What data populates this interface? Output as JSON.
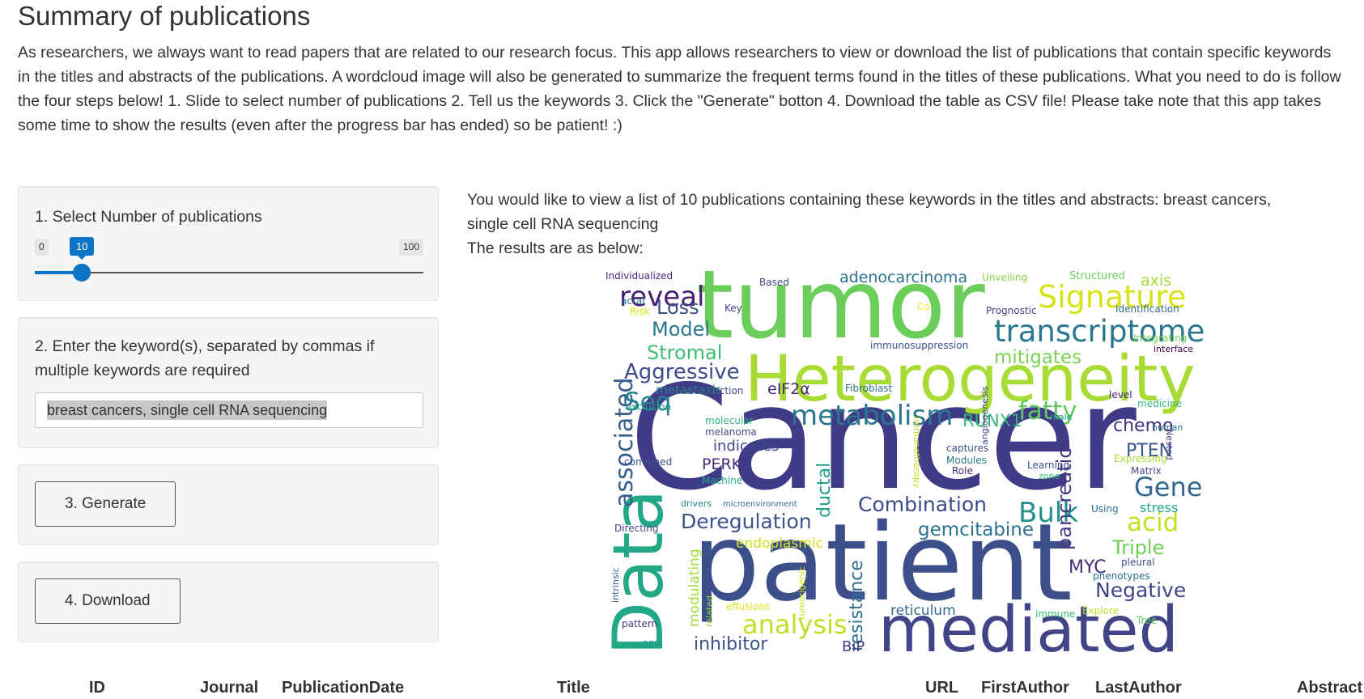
{
  "page": {
    "title": "Summary of publications",
    "intro": "As researchers, we always want to read papers that are related to our research focus. This app allows researchers to view or download the list of publications that contain specific keywords in the titles and abstracts of the publications. A wordcloud image will also be generated to summarize the frequent terms found in the titles of these publications. What you need to do is follow the four steps below! 1. Slide to select number of publications 2. Tell us the keywords 3. Click the \"Generate\" botton 4. Download the table as CSV file! Please take note that this app takes some time to show the results (even after the progress bar has ended) so be patient! :)"
  },
  "sidebar": {
    "step1_label": "1. Select Number of publications",
    "slider": {
      "min": "0",
      "max": "100",
      "value": "10",
      "value_fraction": 0.1,
      "color": "#0b74c6"
    },
    "step2_label": "2. Enter the keyword(s), separated by commas if multiple keywords are required",
    "keyword_value": "breast cancers, single cell RNA sequencing",
    "generate_label": "3. Generate",
    "download_label": "4. Download"
  },
  "results": {
    "line1": "You would like to view a list of 10 publications containing these keywords in the titles and abstracts: breast cancers, single cell RNA sequencing",
    "line2": "The results are as below:"
  },
  "wordcloud": {
    "words": [
      {
        "text": "Cancer",
        "color": "#3f3b87"
      },
      {
        "text": "tumor",
        "color": "#6cce5a"
      },
      {
        "text": "patient",
        "color": "#3c4f8a"
      },
      {
        "text": "Heterogeneity",
        "color": "#a8db34"
      },
      {
        "text": "Data",
        "color": "#22a884"
      },
      {
        "text": "mediated",
        "color": "#414487"
      },
      {
        "text": "Signature",
        "color": "#d8e219"
      },
      {
        "text": "transcriptome",
        "color": "#2a788e"
      },
      {
        "text": "associated",
        "color": "#355f8d"
      },
      {
        "text": "metabolism",
        "color": "#2a768e"
      },
      {
        "text": "reveal",
        "color": "#481f70"
      },
      {
        "text": "Bulk",
        "color": "#21918c"
      },
      {
        "text": "pancreatic",
        "color": "#443983"
      },
      {
        "text": "fatty",
        "color": "#5ec962"
      },
      {
        "text": "Gene",
        "color": "#31688e"
      },
      {
        "text": "acid",
        "color": "#c2df23"
      },
      {
        "text": "analysis",
        "color": "#bddf26"
      },
      {
        "text": "Negative",
        "color": "#414487"
      },
      {
        "text": "Combination",
        "color": "#3e4989"
      },
      {
        "text": "Deregulation",
        "color": "#3b528b"
      },
      {
        "text": "gemcitabine",
        "color": "#2c728e"
      },
      {
        "text": "Aggressive",
        "color": "#3e4a89"
      },
      {
        "text": "Stromal",
        "color": "#3fbc73"
      },
      {
        "text": "Model",
        "color": "#2a788e"
      },
      {
        "text": "Loss",
        "color": "#3b528b"
      },
      {
        "text": "Seq",
        "color": "#26828e"
      },
      {
        "text": "mitigates",
        "color": "#7ad151"
      },
      {
        "text": "ductal",
        "color": "#1f9e89"
      },
      {
        "text": "resistance",
        "color": "#2d708e"
      },
      {
        "text": "Triple",
        "color": "#6ece58"
      },
      {
        "text": "MYC",
        "color": "#472d7b"
      },
      {
        "text": "inhibitor",
        "color": "#3b528b"
      },
      {
        "text": "PTEN",
        "color": "#39568c"
      },
      {
        "text": "chemo",
        "color": "#46327e"
      },
      {
        "text": "RUNX1",
        "color": "#35b779"
      },
      {
        "text": "adenocarcinoma",
        "color": "#2c728e"
      },
      {
        "text": "axis",
        "color": "#a5db36"
      },
      {
        "text": "eIF2α",
        "color": "#482878"
      },
      {
        "text": "PERK",
        "color": "#472c7a"
      },
      {
        "text": "indicates",
        "color": "#3e4a89"
      },
      {
        "text": "BiP",
        "color": "#443a83"
      },
      {
        "text": "reticulum",
        "color": "#31688e"
      },
      {
        "text": "endoplasmic",
        "color": "#d0e11c"
      },
      {
        "text": "modulating",
        "color": "#9fda3a"
      },
      {
        "text": "metastasis",
        "color": "#25858e"
      },
      {
        "text": "stress",
        "color": "#22a884"
      },
      {
        "text": "Structured",
        "color": "#6ccd5a"
      },
      {
        "text": "Unveiling",
        "color": "#86d549"
      },
      {
        "text": "Based",
        "color": "#404688"
      },
      {
        "text": "Individualized",
        "color": "#482677"
      },
      {
        "text": "acral",
        "color": "#2c728e"
      },
      {
        "text": "Risk",
        "color": "#dde318"
      },
      {
        "text": "Key",
        "color": "#433e85"
      },
      {
        "text": "Co",
        "color": "#fde725"
      },
      {
        "text": "Prognostic",
        "color": "#453781"
      },
      {
        "text": "Identification",
        "color": "#31688e"
      },
      {
        "text": "Integrating",
        "color": "#7ad151"
      },
      {
        "text": "interface",
        "color": "#440154"
      },
      {
        "text": "immunosuppression",
        "color": "#3b528b"
      },
      {
        "text": "Fibroblast",
        "color": "#2c728e"
      },
      {
        "text": "Construction",
        "color": "#3e4a89"
      },
      {
        "text": "exclusion",
        "color": "#1f9e89"
      },
      {
        "text": "level",
        "color": "#482475"
      },
      {
        "text": "medicine",
        "color": "#35b779"
      },
      {
        "text": "Nested",
        "color": "#443983"
      },
      {
        "text": "male",
        "color": "#1fa188"
      },
      {
        "text": "human",
        "color": "#2a788e"
      },
      {
        "text": "molecular",
        "color": "#2db27d"
      },
      {
        "text": "melanoma",
        "color": "#3e4989"
      },
      {
        "text": "Immunotherapy",
        "color": "#c2df23"
      },
      {
        "text": "angiogenesis",
        "color": "#3e4989"
      },
      {
        "text": "captures",
        "color": "#3b528b"
      },
      {
        "text": "Modules",
        "color": "#2a788e"
      },
      {
        "text": "Role",
        "color": "#472d7b"
      },
      {
        "text": "Learning",
        "color": "#3b528b"
      },
      {
        "text": "zone",
        "color": "#35b779"
      },
      {
        "text": "Expressing",
        "color": "#a8db34"
      },
      {
        "text": "Matrix",
        "color": "#404688"
      },
      {
        "text": "combined",
        "color": "#3b528b"
      },
      {
        "text": "Machine",
        "color": "#22a884"
      },
      {
        "text": "drivers",
        "color": "#26828e"
      },
      {
        "text": "microenvironment",
        "color": "#2c728e"
      },
      {
        "text": "Directing",
        "color": "#3e4a89"
      },
      {
        "text": "Using",
        "color": "#2d708e"
      },
      {
        "text": "pleural",
        "color": "#3b528b"
      },
      {
        "text": "phenotypes",
        "color": "#2d708e"
      },
      {
        "text": "intrinsic",
        "color": "#355f8d"
      },
      {
        "text": "tumorigenic",
        "color": "#cde11d"
      },
      {
        "text": "related",
        "color": "#8fd744"
      },
      {
        "text": "effusions",
        "color": "#dde318"
      },
      {
        "text": "immune",
        "color": "#35b779"
      },
      {
        "text": "Explore",
        "color": "#b5de2b"
      },
      {
        "text": "Tree",
        "color": "#5ec962"
      },
      {
        "text": "pattern",
        "color": "#453781"
      },
      {
        "text": "scGEM",
        "color": "#1f9a8a"
      }
    ]
  },
  "table": {
    "columns": [
      "ID",
      "Journal",
      "PublicationDate",
      "Title",
      "URL",
      "FirstAuthor",
      "LastAuthor",
      "Abstract"
    ]
  }
}
